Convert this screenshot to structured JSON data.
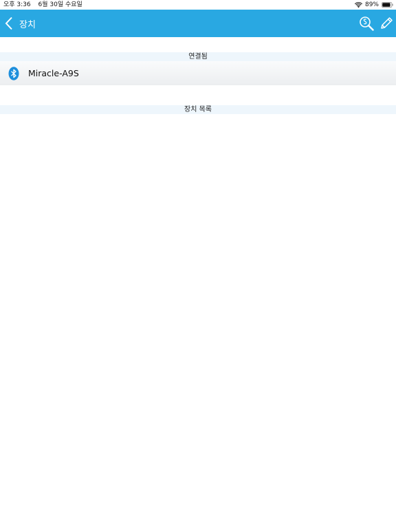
{
  "status_bar": {
    "time": "오후 3:36",
    "date": "6월 30일 수요일",
    "battery": "89%",
    "battery_level": 0.89
  },
  "navbar": {
    "back_icon": "chevron-left-icon",
    "title": "장치",
    "actions": [
      "scan-search-icon",
      "pencil-icon"
    ],
    "color": "#29a8e2"
  },
  "sections": {
    "connected": {
      "title": "연결됨",
      "items": [
        {
          "icon": "bluetooth-icon",
          "name": "Miracle-A9S"
        }
      ]
    },
    "device_list": {
      "title": "장치 목록",
      "items": []
    }
  }
}
